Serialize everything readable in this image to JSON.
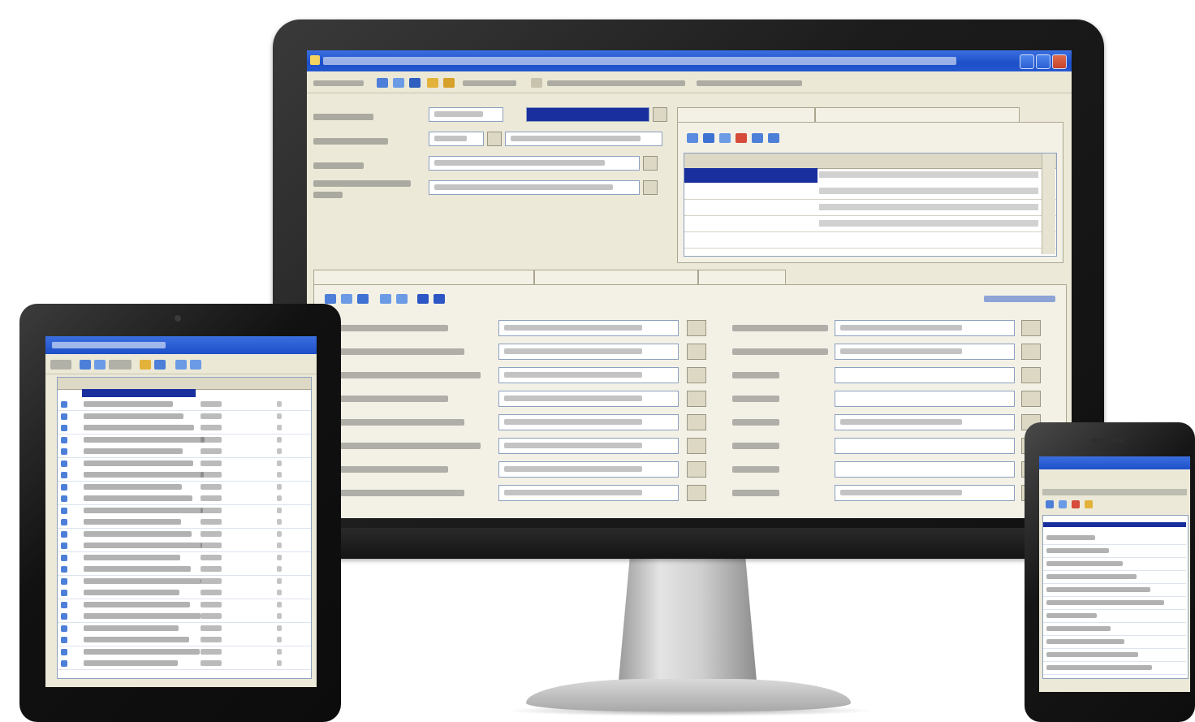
{
  "colors": {
    "window_title_bar": "#1d4fc8",
    "window_background": "#ece9d8",
    "selection": "#1a2f9e",
    "device_body": "#111111",
    "stand": "#c8c8c8"
  },
  "monitor": {
    "window_title": "",
    "toolbar_items": [
      "",
      "",
      ""
    ],
    "header_fields": [
      "",
      "",
      "",
      ""
    ],
    "tabs_top": [
      "",
      ""
    ],
    "grid_rows": [
      "",
      "",
      "",
      "",
      ""
    ],
    "tabs_bottom": [
      "",
      "",
      ""
    ],
    "form_rows_left": [
      "",
      "",
      "",
      "",
      "",
      "",
      "",
      ""
    ],
    "form_rows_right": [
      "",
      "",
      "",
      "",
      "",
      "",
      "",
      ""
    ]
  },
  "tablet": {
    "window_title": "",
    "list_rows": [
      "",
      "",
      "",
      "",
      "",
      "",
      "",
      "",
      "",
      "",
      "",
      "",
      "",
      "",
      "",
      "",
      "",
      "",
      "",
      "",
      "",
      "",
      ""
    ]
  },
  "phone": {
    "list_rows": [
      "",
      "",
      "",
      "",
      "",
      "",
      "",
      "",
      "",
      "",
      ""
    ]
  }
}
